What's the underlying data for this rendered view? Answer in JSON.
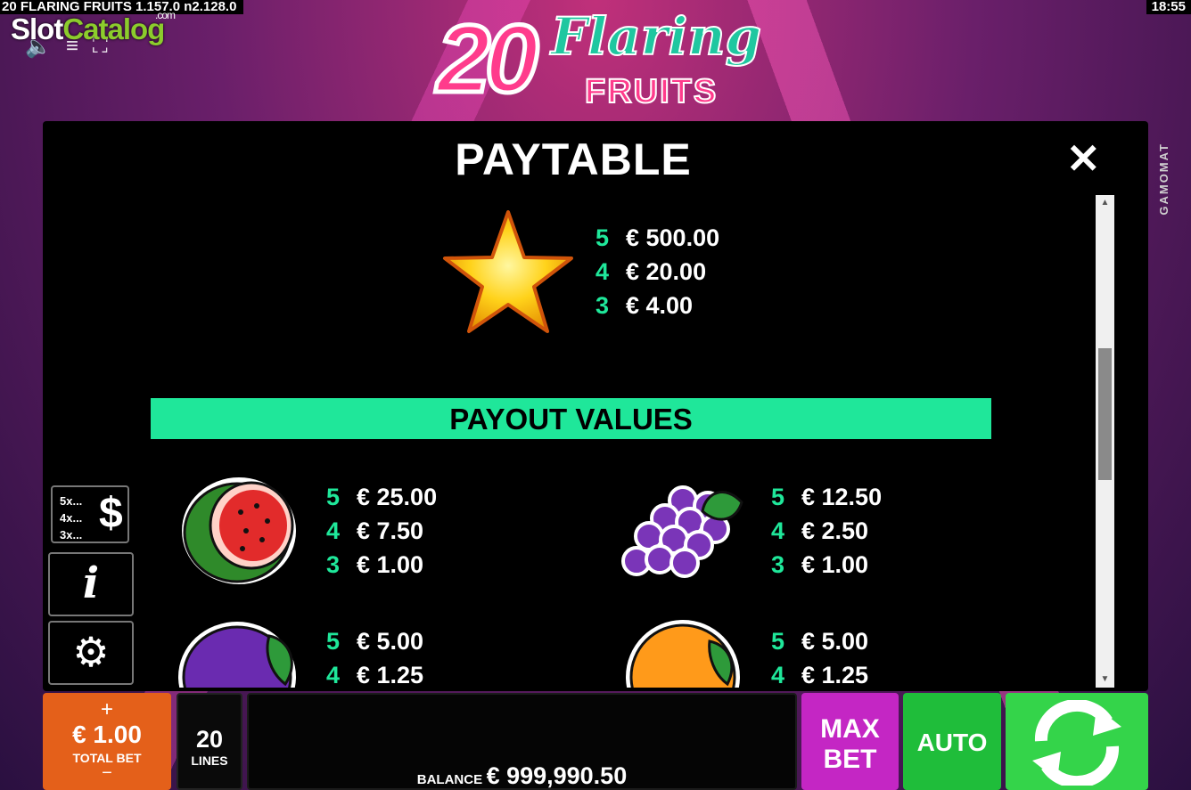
{
  "header": {
    "build": "20 FLARING FRUITS  1.157.0 n2.128.0",
    "clock": "18:55",
    "watermark_a": "Slot",
    "watermark_b": "Catalog",
    "watermark_c": ".com",
    "brand": "GAMOMAT",
    "icons": [
      "speaker-icon",
      "menu-icon",
      "fullscreen-icon"
    ]
  },
  "logo": {
    "number": "20",
    "line1": "Flaring",
    "line2": "FRUITS"
  },
  "paytable": {
    "title": "PAYTABLE",
    "close_label": "✕",
    "payout_header": "PAYOUT VALUES",
    "symbols": [
      {
        "name": "star",
        "pays": [
          {
            "count": "5",
            "value": "€ 500.00"
          },
          {
            "count": "4",
            "value": "€ 20.00"
          },
          {
            "count": "3",
            "value": "€ 4.00"
          }
        ]
      },
      {
        "name": "watermelon",
        "pays": [
          {
            "count": "5",
            "value": "€ 25.00"
          },
          {
            "count": "4",
            "value": "€ 7.50"
          },
          {
            "count": "3",
            "value": "€ 1.00"
          }
        ]
      },
      {
        "name": "grapes",
        "pays": [
          {
            "count": "5",
            "value": "€ 12.50"
          },
          {
            "count": "4",
            "value": "€ 2.50"
          },
          {
            "count": "3",
            "value": "€ 1.00"
          }
        ]
      },
      {
        "name": "plum",
        "pays": [
          {
            "count": "5",
            "value": "€ 5.00"
          },
          {
            "count": "4",
            "value": "€ 1.25"
          }
        ]
      },
      {
        "name": "orange",
        "pays": [
          {
            "count": "5",
            "value": "€ 5.00"
          },
          {
            "count": "4",
            "value": "€ 1.25"
          }
        ]
      }
    ]
  },
  "side": {
    "paytable_btn": {
      "l1": "5x...",
      "l2": "4x...",
      "l3": "3x...",
      "sym": "$"
    },
    "info_btn": "i",
    "settings_btn": "settings-icon"
  },
  "bottom": {
    "bet_plus": "+",
    "bet_value": "€ 1.00",
    "bet_label": "TOTAL BET",
    "bet_minus": "−",
    "lines_value": "20",
    "lines_label": "LINES",
    "balance_label": "BALANCE",
    "balance_value": "€ 999,990.50",
    "maxbet_l1": "MAX",
    "maxbet_l2": "BET",
    "auto_label": "AUTO",
    "spin_icon": "spin-icon"
  },
  "colors": {
    "accent": "#1fe79a",
    "bet": "#e4601a",
    "maxbet": "#c426c4",
    "auto": "#1fbd3a",
    "spin": "#34d44a"
  }
}
